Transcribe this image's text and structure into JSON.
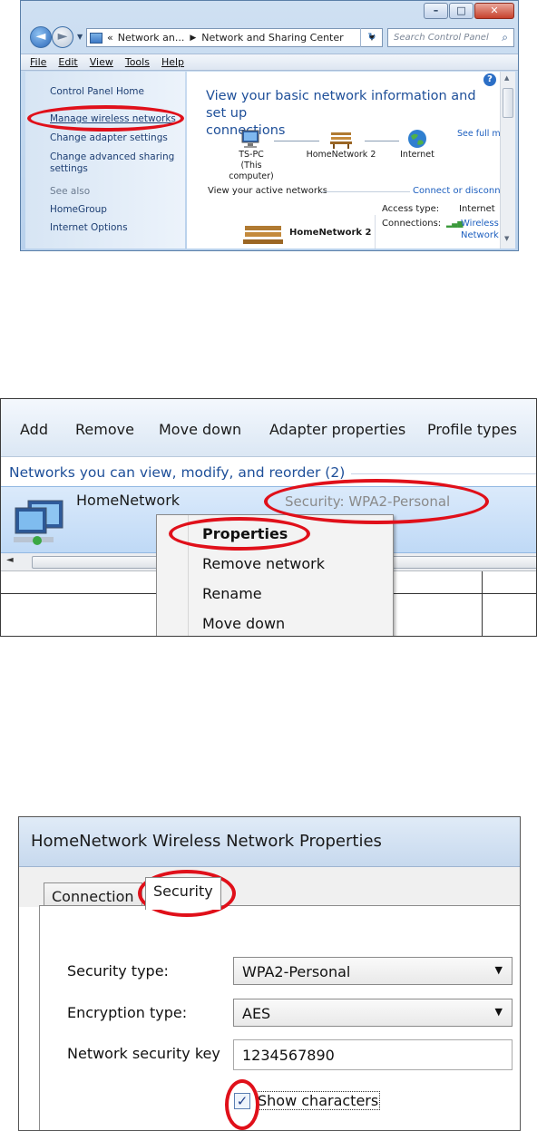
{
  "panel1": {
    "window_caption_buttons": [
      "minimize",
      "maximize",
      "close"
    ],
    "address_breadcrumb": [
      "Network an...",
      "Network and Sharing Center"
    ],
    "address_prefix": "«",
    "search_placeholder": "Search Control Panel",
    "menu": [
      "File",
      "Edit",
      "View",
      "Tools",
      "Help"
    ],
    "left_nav": {
      "home": "Control Panel Home",
      "manage_wireless": "Manage wireless networks",
      "change_adapter": "Change adapter settings",
      "change_advanced_line1": "Change advanced sharing",
      "change_advanced_line2": "settings",
      "see_also": "See also",
      "homegroup": "HomeGroup",
      "internet_options": "Internet Options"
    },
    "content": {
      "title_line1": "View your basic network information and set up",
      "title_line2": "connections",
      "see_full_map": "See full map",
      "node_pc": "TS-PC",
      "node_pc_sub": "(This computer)",
      "node_network": "HomeNetwork  2",
      "node_internet": "Internet",
      "active_networks": "View your active networks",
      "connect_disconnect": "Connect or disconnect",
      "access_type_label": "Access type:",
      "access_type_value": "Internet",
      "connections_label": "Connections:",
      "connections_value_line1": "Wireless",
      "connections_value_line2": "Network",
      "active_network_name": "HomeNetwork  2"
    },
    "highlight_color": "#e0101a"
  },
  "panel2": {
    "toolbar": [
      "Add",
      "Remove",
      "Move down",
      "Adapter properties",
      "Profile types"
    ],
    "header": "Networks you can view, modify, and reorder (2)",
    "network_name": "HomeNetwork",
    "security": "Security:  WPA2-Personal",
    "context_menu": [
      "Properties",
      "Remove network",
      "Rename",
      "Move down"
    ]
  },
  "panel3": {
    "title": "HomeNetwork Wireless Network Properties",
    "tabs": [
      "Connection",
      "Security"
    ],
    "security_type_label": "Security type:",
    "security_type_value": "WPA2-Personal",
    "encryption_type_label": "Encryption type:",
    "encryption_type_value": "AES",
    "network_key_label": "Network security key",
    "network_key_value": "1234567890",
    "show_characters_label": "Show characters",
    "show_characters_checked": true
  }
}
